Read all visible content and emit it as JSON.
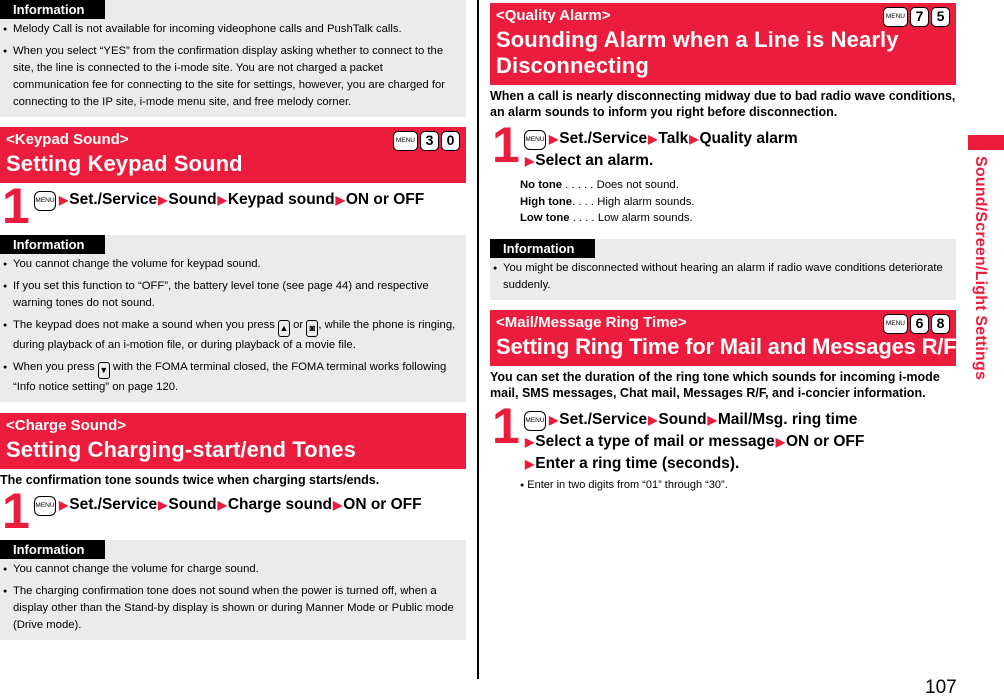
{
  "page_number": "107",
  "side_tab_label": "Sound/Screen/Light Settings",
  "accent_color": "#ec1c3c",
  "info_label": "Information",
  "menu_key_label": "MENU",
  "arrow": "▶",
  "left": {
    "info_top": [
      "Melody Call is not available for incoming videophone calls and PushTalk calls.",
      "When you select “YES” from the confirmation display asking whether to connect to the site, the line is connected to the i-mode site. You are not charged a packet communication fee for connecting to the site for settings, however, you are charged for connecting to the IP site, i-mode menu site, and free melody corner."
    ],
    "keypad": {
      "subtitle": "<Keypad Sound>",
      "title": "Setting Keypad Sound",
      "keys": [
        "3",
        "0"
      ],
      "step_number": "1",
      "path": [
        "Set./Service",
        "Sound",
        "Keypad sound",
        "ON or OFF"
      ],
      "info": [
        "You cannot change the volume for keypad sound.",
        "If you set this function to “OFF”, the battery level tone (see page 44) and respective warning tones do not sound.",
        {
          "pre": "The keypad does not make a sound when you press ",
          "key1": "▲",
          "mid": " or ",
          "key2": "◙",
          "post": ", while the phone is ringing, during playback of an i-motion file, or during playback of a movie file."
        },
        {
          "pre": "When you press ",
          "key1": "▼",
          "post": " with the FOMA terminal closed, the FOMA terminal works following “Info notice setting” on page 120."
        }
      ]
    },
    "charge": {
      "subtitle": "<Charge Sound>",
      "title": "Setting Charging-start/end Tones",
      "lead": "The confirmation tone sounds twice when charging starts/ends.",
      "step_number": "1",
      "path": [
        "Set./Service",
        "Sound",
        "Charge sound",
        "ON or OFF"
      ],
      "info": [
        "You cannot change the volume for charge sound.",
        "The charging confirmation tone does not sound when the power is turned off, when a display other than the Stand-by display is shown or during Manner Mode or Public mode (Drive mode)."
      ]
    }
  },
  "right": {
    "quality": {
      "subtitle": "<Quality Alarm>",
      "title": "Sounding Alarm when a Line is Nearly Disconnecting",
      "keys": [
        "7",
        "5"
      ],
      "lead": "When a call is nearly disconnecting midway due to bad radio wave conditions, an alarm sounds to inform you right before disconnection.",
      "step_number": "1",
      "path_line1": [
        "Set./Service",
        "Talk",
        "Quality alarm"
      ],
      "path_line2": "Select an alarm.",
      "options": [
        {
          "name": "No tone",
          "dots": " . . . . . ",
          "desc": "Does not sound."
        },
        {
          "name": "High tone",
          "dots": ". . . . ",
          "desc": "High alarm sounds."
        },
        {
          "name": "Low tone",
          "dots": " . . . . ",
          "desc": "Low alarm sounds."
        }
      ],
      "info": [
        "You might be disconnected without hearing an alarm if radio wave conditions deteriorate suddenly."
      ]
    },
    "mail": {
      "subtitle": "<Mail/Message Ring Time>",
      "title": "Setting Ring Time for Mail and Messages R/F",
      "keys": [
        "6",
        "8"
      ],
      "lead": "You can set the duration of the ring tone which sounds for incoming i-mode mail, SMS messages, Chat mail, Messages R/F, and i-concier information.",
      "step_number": "1",
      "path_line1": [
        "Set./Service",
        "Sound",
        "Mail/Msg. ring time"
      ],
      "path_line2": [
        "Select a type of mail or message",
        "ON or OFF"
      ],
      "path_line3": "Enter a ring time (seconds).",
      "note": "Enter in two digits from “01” through “30”."
    }
  }
}
